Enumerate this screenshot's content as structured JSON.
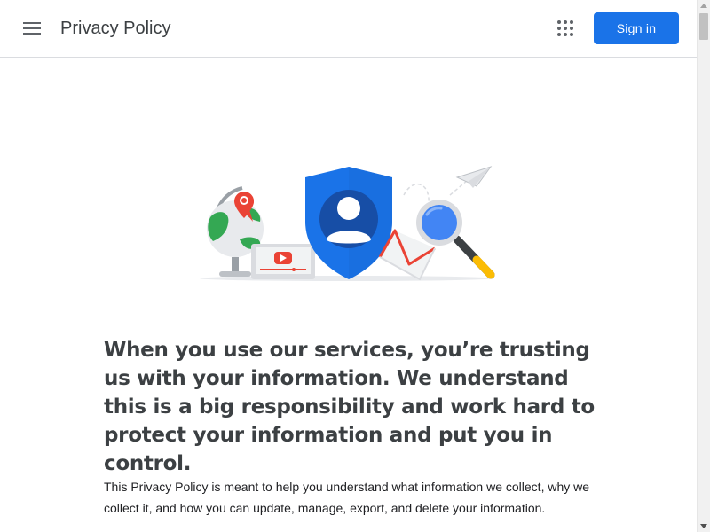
{
  "header": {
    "title": "Privacy Policy",
    "menu_icon": "hamburger-menu-icon",
    "apps_icon": "apps-grid-icon",
    "signin_label": "Sign in"
  },
  "hero": {
    "icons": [
      "globe-icon",
      "map-pin-icon",
      "youtube-player-icon",
      "shield-account-icon",
      "gmail-envelope-icon",
      "magnifier-icon",
      "paper-plane-icon"
    ]
  },
  "main": {
    "headline": "When you use our services, you’re trusting us with your information. We understand this is a big responsibility and work hard to protect your information and put you in control.",
    "intro": "This Privacy Policy is meant to help you understand what information we collect, why we collect it, and how you can update, manage, export, and delete your information."
  },
  "colors": {
    "brand_blue": "#1a73e8",
    "google_red": "#ea4335",
    "google_green": "#34a853",
    "google_yellow": "#fbbc04",
    "text_dark": "#3c4043"
  }
}
